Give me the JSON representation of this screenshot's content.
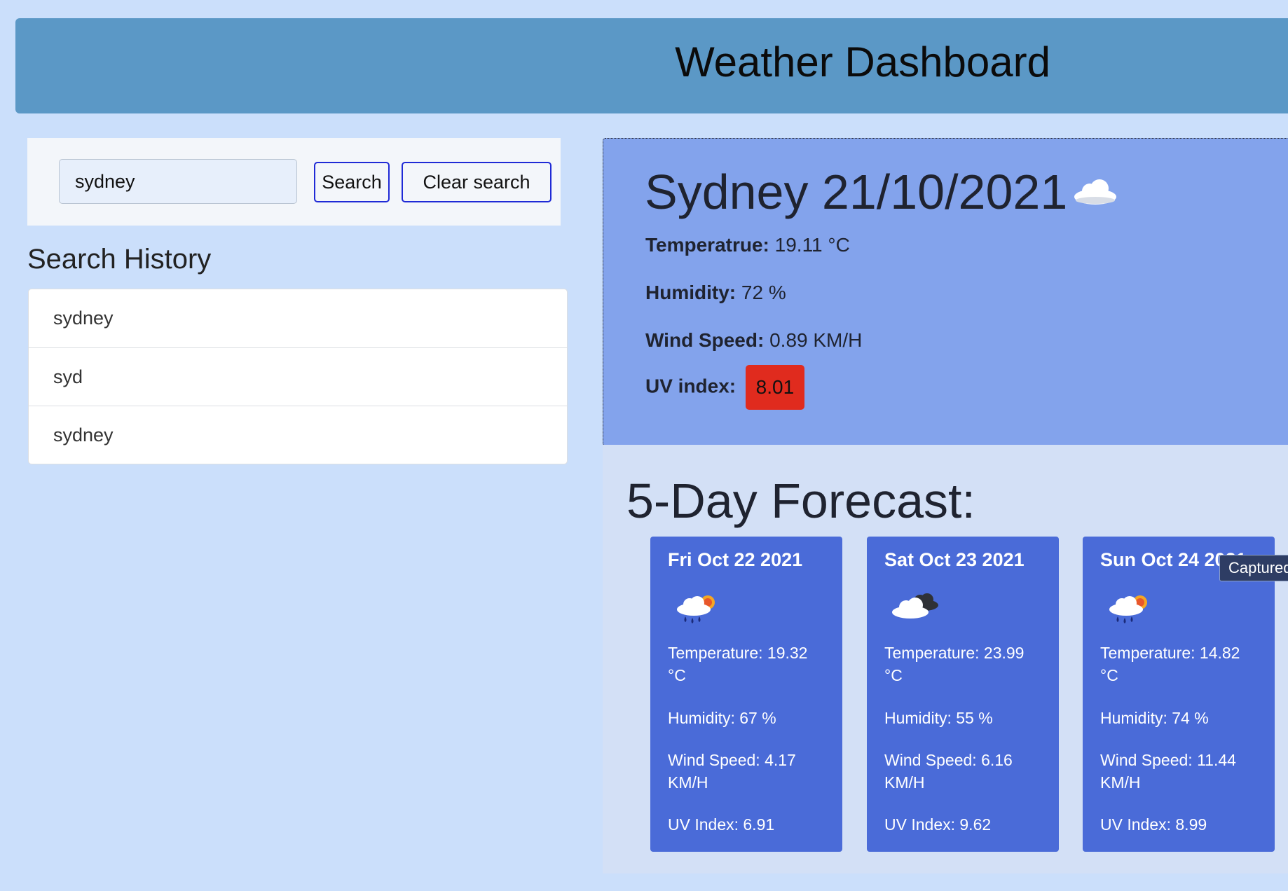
{
  "header": {
    "title": "Weather Dashboard"
  },
  "search": {
    "value": "sydney",
    "search_label": "Search",
    "clear_label": "Clear search"
  },
  "history": {
    "title": "Search History",
    "items": [
      {
        "label": "sydney"
      },
      {
        "label": "syd"
      },
      {
        "label": "sydney"
      }
    ]
  },
  "current": {
    "title": "Sydney 21/10/2021",
    "icon": "cloud-icon",
    "temp_label": "Temperatrue:",
    "temp_value": "19.11 °C",
    "humidity_label": "Humidity:",
    "humidity_value": "72 %",
    "wind_label": "Wind Speed:",
    "wind_value": "0.89 KM/H",
    "uv_label": "UV index:",
    "uv_value": "8.01",
    "uv_color": "#e02b1e"
  },
  "forecast": {
    "title": "5-Day Forecast:",
    "days": [
      {
        "date": "Fri Oct 22 2021",
        "icon": "rain-sun-cloud-icon",
        "temp_line1": "Temperature: 19.32",
        "temp_line2": "°C",
        "humidity": "Humidity: 67 %",
        "wind_line1": "Wind Speed: 4.17",
        "wind_line2": "KM/H",
        "uv": "UV Index: 6.91"
      },
      {
        "date": "Sat Oct 23 2021",
        "icon": "dark-cloud-icon",
        "temp_line1": "Temperature: 23.99",
        "temp_line2": "°C",
        "humidity": "Humidity: 55 %",
        "wind_line1": "Wind Speed: 6.16",
        "wind_line2": "KM/H",
        "uv": "UV Index: 9.62"
      },
      {
        "date": "Sun Oct 24 2021",
        "icon": "rain-sun-cloud-icon",
        "temp_line1": "Temperature: 14.82",
        "temp_line2": "°C",
        "humidity": "Humidity: 74 %",
        "wind_line1": "Wind Speed: 11.44",
        "wind_line2": "KM/H",
        "uv": "UV Index: 8.99"
      }
    ]
  },
  "tooltip": {
    "text": "Captured"
  },
  "colors": {
    "page_bg": "#cbdffb",
    "header_bg": "#5b98c6",
    "current_bg": "#83a3ec",
    "card_bg": "#4a6bd8"
  }
}
